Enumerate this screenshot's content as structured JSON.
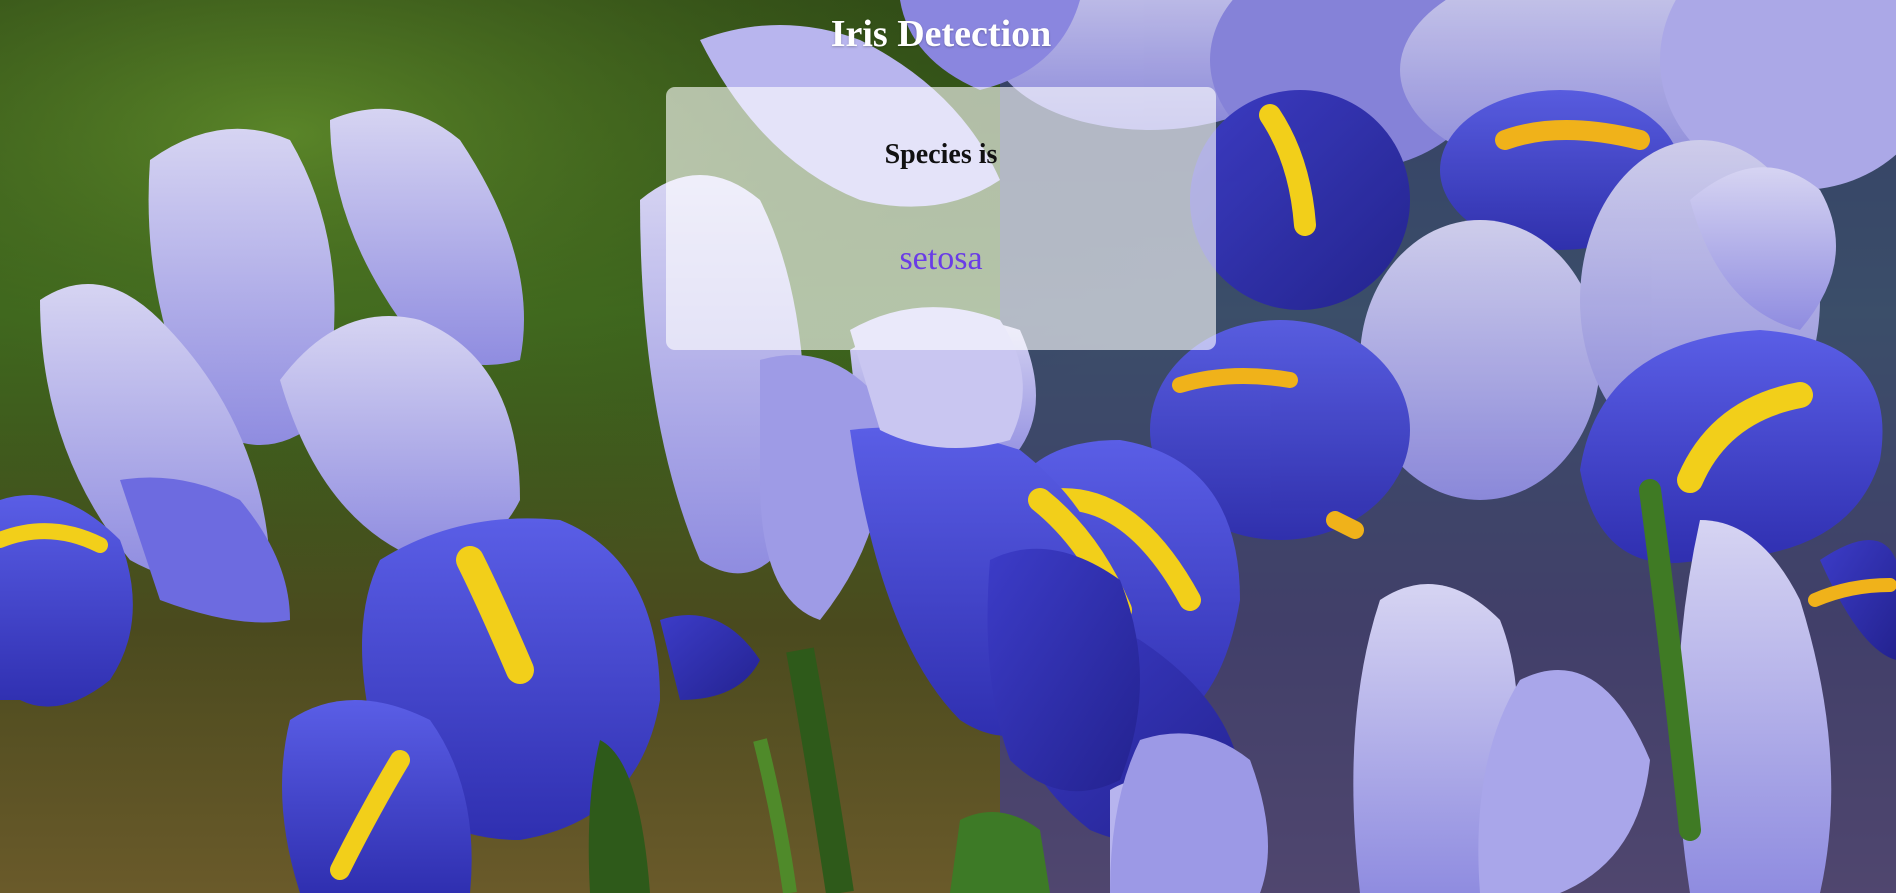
{
  "page": {
    "title": "Iris Detection"
  },
  "result": {
    "heading": "Species is",
    "species": "setosa"
  },
  "colors": {
    "title_text": "#ffffff",
    "heading_text": "#111111",
    "species_text": "#6a3ce6",
    "card_background": "rgba(255,255,255,0.62)",
    "petal_blue": "#4b4fd6",
    "petal_lavender": "#a9a6ea",
    "iris_signal_yellow": "#f2cf1a",
    "foliage_green": "#3f6a22"
  },
  "background_image": {
    "subject": "blue iris flowers"
  }
}
